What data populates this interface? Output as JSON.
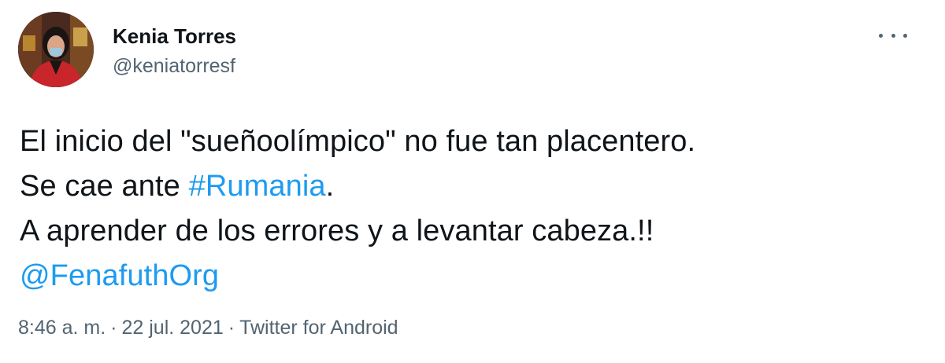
{
  "author": {
    "display_name": "Kenia Torres",
    "handle": "@keniatorresf"
  },
  "tweet": {
    "line1": "El inicio del \"sueñoolímpico\" no fue tan placentero.",
    "line2_prefix": "Se cae ante ",
    "line2_hashtag": "#Rumania",
    "line2_suffix": ".",
    "line3": "A aprender de los errores y a levantar cabeza.!!",
    "line4_mention": "@FenafuthOrg"
  },
  "meta": {
    "time": "8:46 a. m.",
    "separator": "·",
    "date": "22 jul. 2021",
    "source": "Twitter for Android"
  },
  "icons": {
    "more": "more-horizontal-icon",
    "avatar": "avatar-photo"
  },
  "colors": {
    "link": "#1d9bf0",
    "secondary_text": "#536471",
    "primary_text": "#0f1419"
  }
}
